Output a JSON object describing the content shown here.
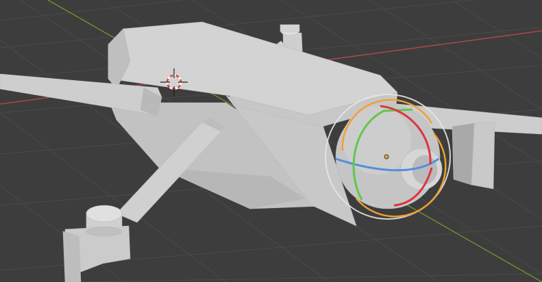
{
  "viewport": {
    "background_color": "#3d3d3d",
    "grid_color": "#4a4a4a",
    "x_axis_color": "#c0474f",
    "y_axis_color": "#6c9a2e"
  },
  "model": {
    "body_color": "#cfcfcf",
    "shadow_color": "#a8a8a8",
    "highlight_color": "#e0e0e0"
  },
  "gizmo": {
    "type": "rotate",
    "outer_ring_color": "#e6e6e6",
    "x_color": "#e0343f",
    "y_color": "#62c74a",
    "z_color": "#4f8fe0",
    "trackball_color": "#f0a030",
    "pivot_color": "#f0a030"
  },
  "cursor": {
    "type": "3d-cursor",
    "ring_colors": [
      "#e33c3c",
      "#ffffff"
    ]
  }
}
